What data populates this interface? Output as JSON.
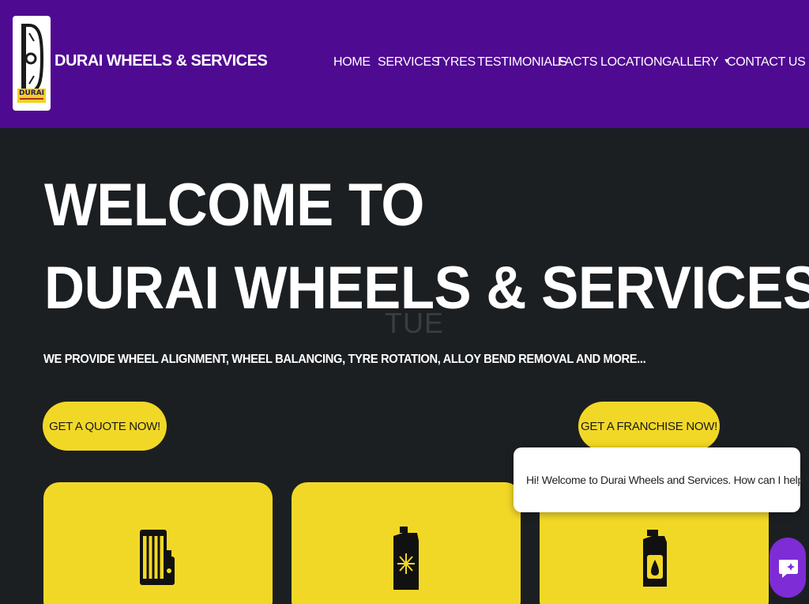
{
  "header": {
    "brand": "DURAI WHEELS & SERVICES",
    "logo_text": "DURAI",
    "bg_color": "#4f0a92"
  },
  "nav": {
    "items": [
      {
        "label": "HOME"
      },
      {
        "label": "SERVICES"
      },
      {
        "label": "TYRES"
      },
      {
        "label": "TESTIMONIALS"
      },
      {
        "label": "FACTS"
      },
      {
        "label": "LOCATION"
      },
      {
        "label": "GALLERY",
        "has_dropdown": true
      },
      {
        "label": "CONTACT US"
      }
    ]
  },
  "hero": {
    "title_line1": "WELCOME TO",
    "title_line2": "DURAI WHEELS & SERVICES",
    "ghost_text": "TUE",
    "tagline": "WE PROVIDE WHEEL ALIGNMENT, WHEEL BALANCING, TYRE ROTATION, ALLOY BEND REMOVAL AND MORE...",
    "cta_quote": "GET A QUOTE NOW!",
    "cta_franchise": "GET A FRANCHISE NOW!"
  },
  "cards": [
    {
      "icon": "oil-filter-icon"
    },
    {
      "icon": "coolant-icon"
    },
    {
      "icon": "engine-oil-icon"
    }
  ],
  "chat": {
    "message": "Hi! Welcome to Durai Wheels and Services. How can I help you?",
    "launcher_icon": "chat-icon"
  },
  "colors": {
    "accent_yellow": "#f2d826",
    "page_bg": "#1c1f22",
    "chat_purple": "#7d2cd6"
  }
}
